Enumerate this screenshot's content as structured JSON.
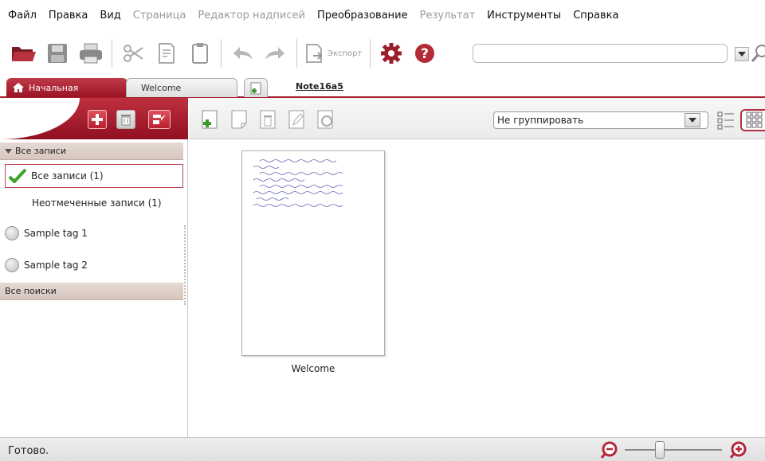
{
  "menu": {
    "items": [
      {
        "label": "Файл",
        "enabled": true
      },
      {
        "label": "Правка",
        "enabled": true
      },
      {
        "label": "Вид",
        "enabled": true
      },
      {
        "label": "Страница",
        "enabled": false
      },
      {
        "label": "Редактор надписей",
        "enabled": false
      },
      {
        "label": "Преобразование",
        "enabled": true
      },
      {
        "label": "Результат",
        "enabled": false
      },
      {
        "label": "Инструменты",
        "enabled": true
      },
      {
        "label": "Справка",
        "enabled": true
      }
    ]
  },
  "toolbar": {
    "export_label": "Экспорт",
    "search_value": ""
  },
  "tabs": {
    "home_label": "Начальная",
    "welcome_label": "Welcome",
    "note_label": "Note16a5"
  },
  "sidebar": {
    "all_notes_header": "Все записи",
    "all_notes_item": "Все записи (1)",
    "untagged_item": "Неотмеченные записи (1)",
    "tag1": "Sample tag 1",
    "tag2": "Sample tag 2",
    "all_searches_header": "Все поиски"
  },
  "content": {
    "group_by_value": "Не группировать",
    "note_title": "Welcome"
  },
  "status": {
    "text": "Готово."
  },
  "colors": {
    "accent": "#a51d2d",
    "accent_light": "#c13a48"
  }
}
